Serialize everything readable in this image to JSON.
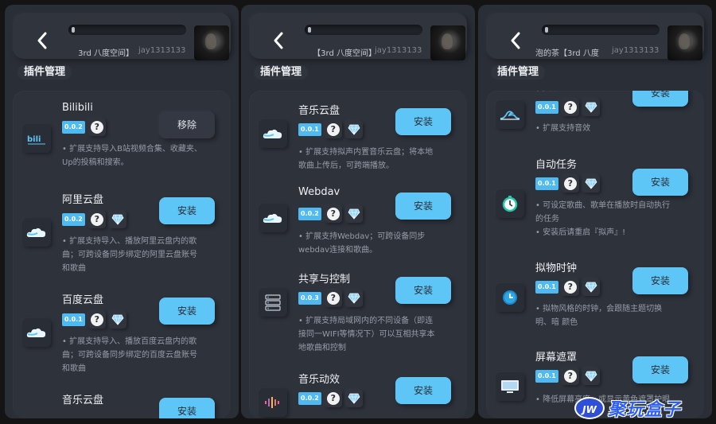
{
  "panels": [
    {
      "song": "3rd 八度空间】",
      "artist": "jay1313133",
      "section_title": "插件管理",
      "plugins": [
        {
          "name": "Bilibili",
          "version": "0.0.2",
          "diamond": false,
          "action": "移除",
          "icon": "bilibili-icon",
          "desc": [
            "• 扩展支持导入B站视频合集、收藏夹、",
            "Up的投稿和搜索。"
          ]
        },
        {
          "name": "阿里云盘",
          "version": "0.0.2",
          "diamond": true,
          "action": "安装",
          "icon": "cloud-icon",
          "desc": [
            "• 扩展支持导入、播放阿里云盘内的歌",
            "曲；可跨设备同步绑定的阿里云盘账号",
            "和歌曲"
          ]
        },
        {
          "name": "百度云盘",
          "version": "0.0.1",
          "diamond": true,
          "action": "安装",
          "icon": "cloud-icon",
          "desc": [
            "• 扩展支持导入、播放百度云盘内的歌",
            "曲；可跨设备同步绑定的百度云盘账号",
            "和歌曲"
          ]
        },
        {
          "name": "音乐云盘",
          "version": "",
          "diamond": false,
          "action": "安装",
          "icon": "cloud-icon",
          "desc": []
        }
      ]
    },
    {
      "song": "【3rd 八度空间】",
      "artist": "jay1313133",
      "section_title": "插件管理",
      "plugins": [
        {
          "name": "音乐云盘",
          "version": "0.0.1",
          "diamond": true,
          "action": "安装",
          "icon": "cloud-icon",
          "desc": [
            "• 扩展支持拟声内置音乐云盘；将本地",
            "歌曲上传后，可跨端播放。"
          ]
        },
        {
          "name": "Webdav",
          "version": "0.0.2",
          "diamond": true,
          "action": "安装",
          "icon": "cloud-icon",
          "desc": [
            "• 扩展支持Webdav；可跨设备同步",
            "webdav连接和歌曲。"
          ]
        },
        {
          "name": "共享与控制",
          "version": "0.0.3",
          "diamond": true,
          "action": "安装",
          "icon": "server-icon",
          "desc": [
            "• 扩展支持局域网内的不同设备（即连",
            "接同一WIFI等情况下）可以互相共享本",
            "地歌曲和控制"
          ]
        },
        {
          "name": "音乐动效",
          "version": "0.0.2",
          "diamond": true,
          "action": "安装",
          "icon": "sound-wave-icon",
          "desc": []
        }
      ]
    },
    {
      "song": "泡的茶【3rd 八度",
      "artist": "jay1313133",
      "section_title": "插件管理",
      "plugins": [
        {
          "name": "音效",
          "version": "0.0.1",
          "diamond": true,
          "action": "安装",
          "icon": "wave-icon",
          "desc": [
            "• 扩展支持音效"
          ]
        },
        {
          "name": "自动任务",
          "version": "0.0.1",
          "diamond": true,
          "action": "安装",
          "icon": "timer-icon",
          "desc": [
            "• 可设定歌曲、歌单在播放时自动执行",
            "的任务",
            "• 安装后请重启『拟声』!"
          ]
        },
        {
          "name": "拟物时钟",
          "version": "0.0.1",
          "diamond": true,
          "action": "安装",
          "icon": "clock-icon",
          "desc": [
            "• 拟物风格的时钟，会跟随主题切换",
            "明、暗 颜色"
          ]
        },
        {
          "name": "屏幕遮罩",
          "version": "0.0.1",
          "diamond": true,
          "action": "安装",
          "icon": "monitor-icon",
          "desc": [
            "• 降低屏幕亮度，或显示黄色遮罩护眼"
          ]
        }
      ]
    }
  ],
  "watermark": {
    "logo": "JW",
    "text": "聚玩盒子"
  },
  "colors": {
    "accent": "#5ec6f7",
    "version_badge": "#4fb9f2",
    "panel": "#2a2e37"
  }
}
